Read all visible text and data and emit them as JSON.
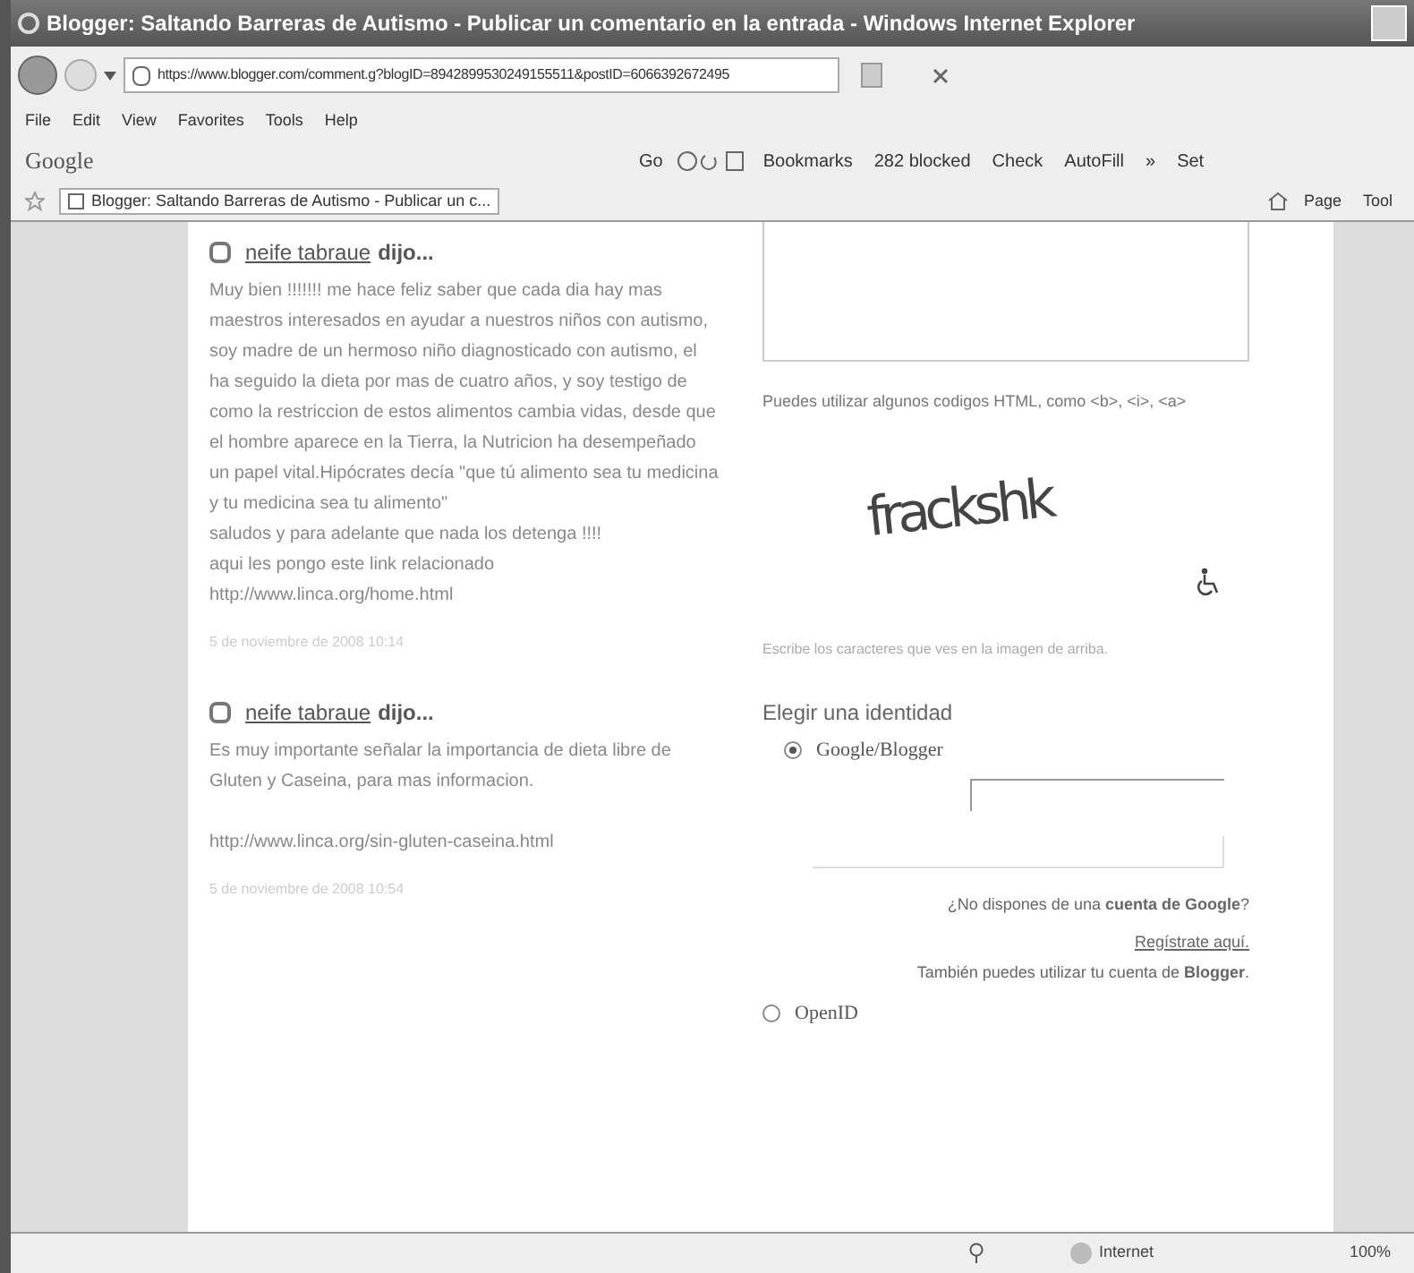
{
  "window": {
    "title": "Blogger: Saltando Barreras de Autismo - Publicar un comentario en la entrada - Windows Internet Explorer"
  },
  "address_bar": {
    "url": "https://www.blogger.com/comment.g?blogID=8942899530249155511&postID=6066392672495"
  },
  "menu": [
    "File",
    "Edit",
    "View",
    "Favorites",
    "Tools",
    "Help"
  ],
  "google_toolbar": {
    "logo": "Google",
    "go": "Go",
    "items": [
      "Bookmarks",
      "282 blocked",
      "Check",
      "AutoFill",
      "»",
      "Set"
    ]
  },
  "tab": {
    "title": "Blogger: Saltando Barreras de Autismo - Publicar un c...",
    "tools": [
      "Page",
      "Tool"
    ]
  },
  "comments": [
    {
      "author": "neife tabraue",
      "said": "dijo...",
      "body": "Muy bien !!!!!!! me hace feliz saber que cada dia hay mas maestros interesados en ayudar a nuestros niños con autismo, soy madre de un hermoso niño diagnosticado con autismo, el ha seguido la dieta por mas de cuatro años, y soy testigo de como la restriccion de estos alimentos cambia vidas, desde que el hombre aparece en la Tierra, la Nutricion ha desempeñado un papel vital.Hipócrates decía \"que tú alimento sea tu medicina y tu medicina sea tu alimento\"\nsaludos y para adelante que nada los detenga !!!!\naqui les pongo este link relacionado\nhttp://www.linca.org/home.html",
      "date": "5 de noviembre de 2008 10:14"
    },
    {
      "author": "neife tabraue",
      "said": "dijo...",
      "body": "Es muy importante señalar la importancia de dieta libre de Gluten y Caseina, para mas informacion.\n\nhttp://www.linca.org/sin-gluten-caseina.html",
      "date": "5 de noviembre de 2008 10:54"
    }
  ],
  "form": {
    "html_hint": "Puedes utilizar algunos codigos HTML, como <b>, <i>, <a>",
    "captcha": "frackshk",
    "captcha_hint": "Escribe los caracteres que ves en la imagen de arriba.",
    "identity_heading": "Elegir una identidad",
    "identities": [
      {
        "label": "Google/Blogger",
        "selected": true
      },
      {
        "label": "OpenID",
        "selected": false
      }
    ],
    "no_account": "¿No dispones de una **cuenta de Google**?",
    "register": "Regístrate aquí.",
    "also": "También puedes utilizar tu cuenta de **Blogger**."
  },
  "status_bar": {
    "zone": "Internet",
    "zoom": "100%"
  }
}
